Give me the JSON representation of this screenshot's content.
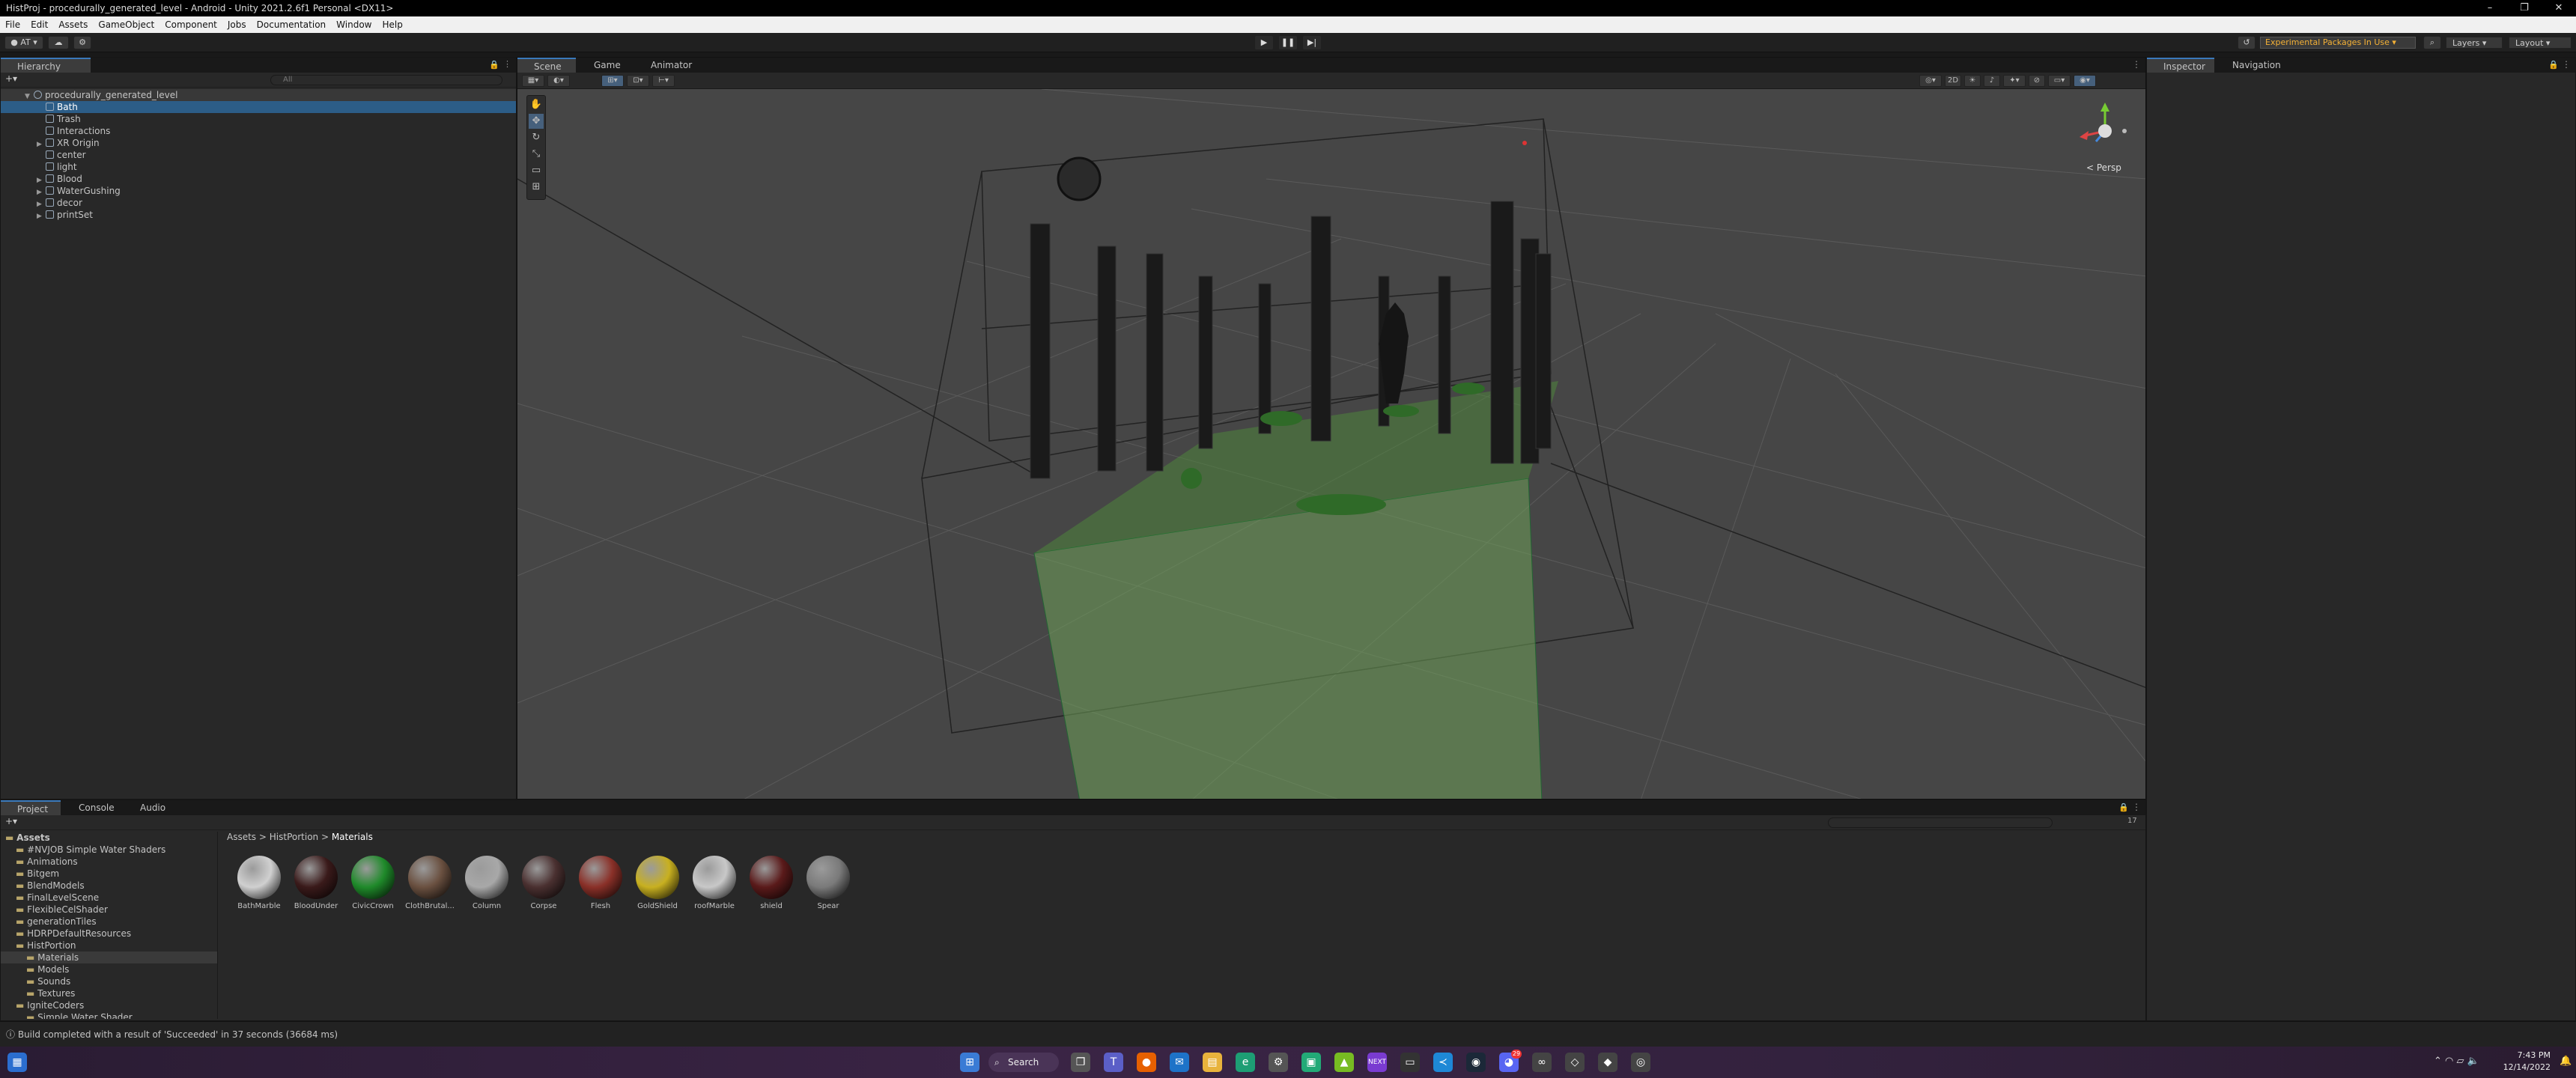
{
  "window": {
    "title": "HistProj - procedurally_generated_level - Android - Unity 2021.2.6f1 Personal <DX11>",
    "controls": [
      "–",
      "❐",
      "✕"
    ]
  },
  "menu": [
    "File",
    "Edit",
    "Assets",
    "GameObject",
    "Component",
    "Jobs",
    "Documentation",
    "Window",
    "Help"
  ],
  "toolbar": {
    "account": "AT",
    "experimental": "Experimental Packages In Use",
    "layers": "Layers",
    "layout": "Layout"
  },
  "hierarchy": {
    "tab": "Hierarchy",
    "search_placeholder": "All",
    "scene": "procedurally_generated_level",
    "items": [
      {
        "label": "Bath",
        "selected": true,
        "expand": false
      },
      {
        "label": "Trash",
        "selected": false,
        "expand": false
      },
      {
        "label": "Interactions",
        "selected": false,
        "expand": false
      },
      {
        "label": "XR Origin",
        "selected": false,
        "expand": true
      },
      {
        "label": "center",
        "selected": false,
        "expand": false
      },
      {
        "label": "light",
        "selected": false,
        "expand": false
      },
      {
        "label": "Blood",
        "selected": false,
        "expand": true
      },
      {
        "label": "WaterGushing",
        "selected": false,
        "expand": true
      },
      {
        "label": "decor",
        "selected": false,
        "expand": true
      },
      {
        "label": "printSet",
        "selected": false,
        "expand": true
      }
    ]
  },
  "scene_tabs": [
    {
      "label": "Scene",
      "active": true
    },
    {
      "label": "Game",
      "active": false
    },
    {
      "label": "Animator",
      "active": false
    }
  ],
  "scene_view": {
    "projection": "< Persp"
  },
  "inspector_tabs": [
    {
      "label": "Inspector",
      "active": true
    },
    {
      "label": "Navigation",
      "active": false
    }
  ],
  "project_tabs": [
    {
      "label": "Project",
      "active": true
    },
    {
      "label": "Console",
      "active": false
    },
    {
      "label": "Audio Mixer",
      "active": false
    }
  ],
  "project_tree": [
    {
      "label": "Assets",
      "indent": 0,
      "bold": true,
      "selected": false
    },
    {
      "label": "#NVJOB Simple Water Shaders",
      "indent": 1,
      "bold": false,
      "selected": false
    },
    {
      "label": "Animations",
      "indent": 1,
      "bold": false,
      "selected": false
    },
    {
      "label": "Bitgem",
      "indent": 1,
      "bold": false,
      "selected": false
    },
    {
      "label": "BlendModels",
      "indent": 1,
      "bold": false,
      "selected": false
    },
    {
      "label": "FinalLevelScene",
      "indent": 1,
      "bold": false,
      "selected": false
    },
    {
      "label": "FlexibleCelShader",
      "indent": 1,
      "bold": false,
      "selected": false
    },
    {
      "label": "generationTiles",
      "indent": 1,
      "bold": false,
      "selected": false
    },
    {
      "label": "HDRPDefaultResources",
      "indent": 1,
      "bold": false,
      "selected": false
    },
    {
      "label": "HistPortion",
      "indent": 1,
      "bold": false,
      "selected": false
    },
    {
      "label": "Materials",
      "indent": 2,
      "bold": false,
      "selected": true
    },
    {
      "label": "Models",
      "indent": 2,
      "bold": false,
      "selected": false
    },
    {
      "label": "Sounds",
      "indent": 2,
      "bold": false,
      "selected": false
    },
    {
      "label": "Textures",
      "indent": 2,
      "bold": false,
      "selected": false
    },
    {
      "label": "IgniteCoders",
      "indent": 1,
      "bold": false,
      "selected": false
    },
    {
      "label": "Simple Water Shader",
      "indent": 2,
      "bold": false,
      "selected": false
    }
  ],
  "breadcrumb": [
    "Assets",
    "HistPortion",
    "Materials"
  ],
  "assets": [
    {
      "label": "BathMarble",
      "color": "#d0d0d0"
    },
    {
      "label": "BloodUnder",
      "color": "#3a1a1a"
    },
    {
      "label": "CivicCrown",
      "color": "#1f8a2a"
    },
    {
      "label": "ClothBrutal...",
      "color": "#6a5040"
    },
    {
      "label": "Column",
      "color": "#a8a8a8"
    },
    {
      "label": "Corpse",
      "color": "#4a3030"
    },
    {
      "label": "Flesh",
      "color": "#8a3028"
    },
    {
      "label": "GoldShield",
      "color": "#c8b020"
    },
    {
      "label": "roofMarble",
      "color": "#c8c8c8"
    },
    {
      "label": "shield",
      "color": "#5a1a1a"
    },
    {
      "label": "Spear",
      "color": "#7a7a7a"
    }
  ],
  "asset_count": "17",
  "status": "Build completed with a result of 'Succeeded' in 37 seconds (36684 ms)",
  "taskbar": {
    "search": "Search",
    "time": "7:43 PM",
    "date": "12/14/2022",
    "badge": "29"
  }
}
